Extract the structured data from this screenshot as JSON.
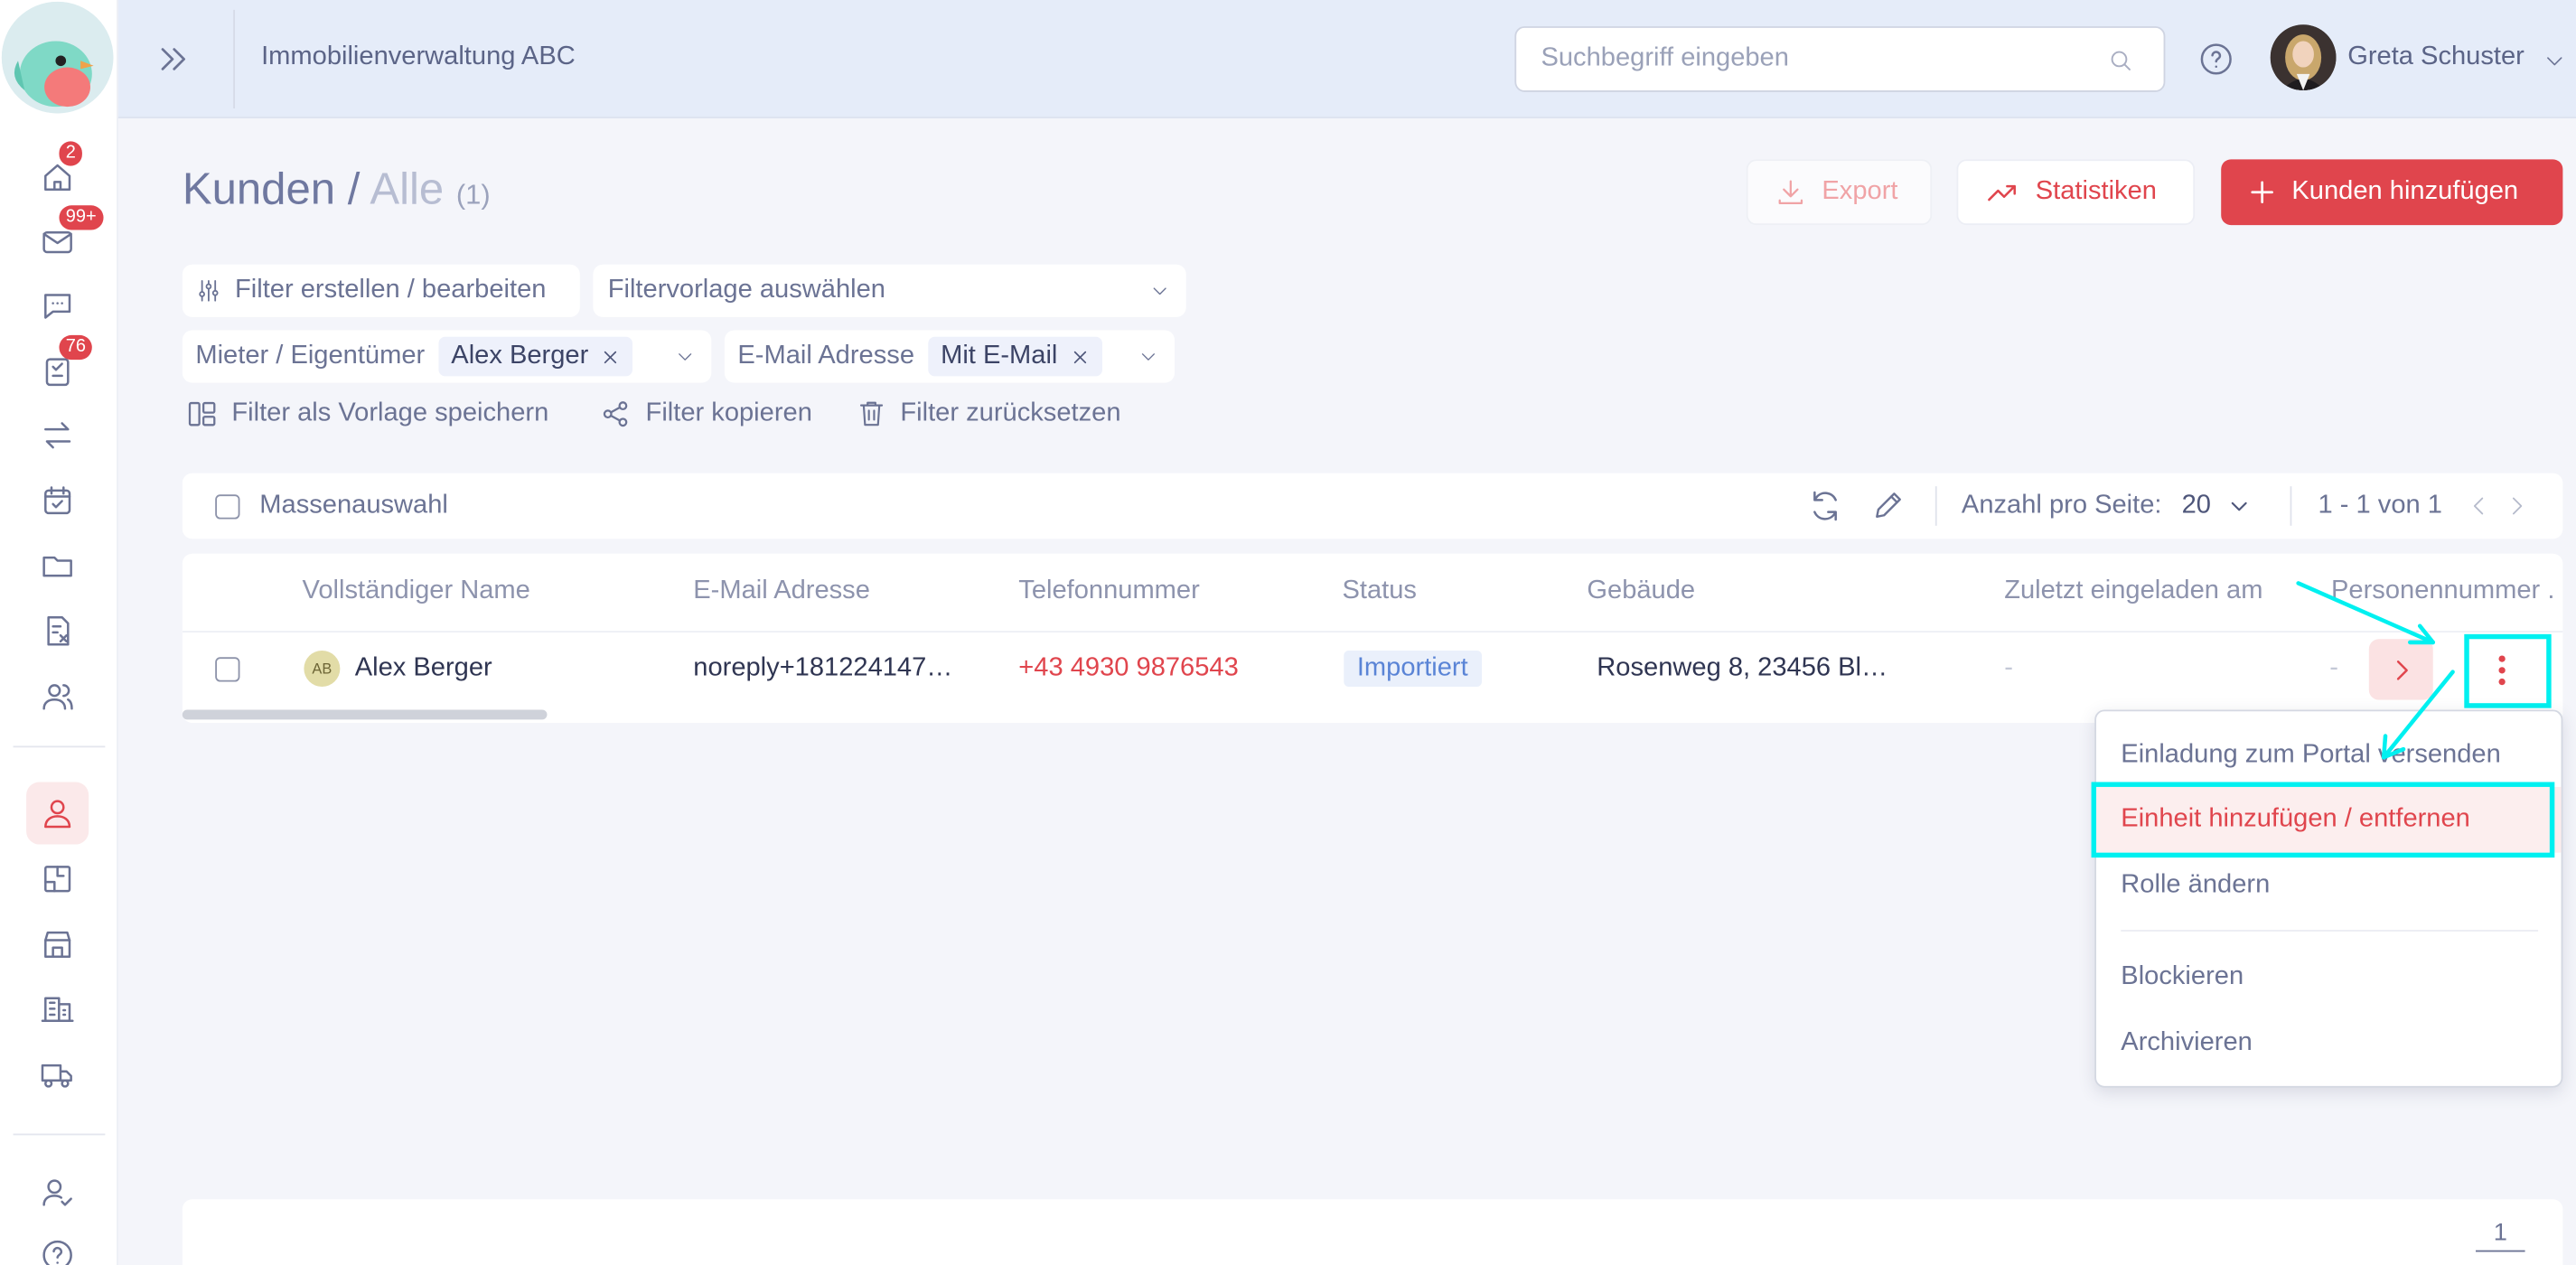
{
  "header": {
    "company": "Immobilienverwaltung ABC",
    "search_placeholder": "Suchbegriff eingeben",
    "user_name": "Greta Schuster"
  },
  "sidebar": {
    "badges": {
      "home": "2",
      "mail": "99+",
      "tasks": "76"
    }
  },
  "page": {
    "title": "Kunden",
    "separator": "/",
    "subtitle": "Alle",
    "count": "(1)",
    "export_label": "Export",
    "stats_label": "Statistiken",
    "add_label": "Kunden hinzufügen"
  },
  "filters": {
    "edit_label": "Filter erstellen / bearbeiten",
    "template_placeholder": "Filtervorlage auswählen",
    "tenant_label": "Mieter / Eigentümer",
    "tenant_value": "Alex Berger",
    "email_label": "E-Mail Adresse",
    "email_value": "Mit E-Mail",
    "save_template": "Filter als Vorlage speichern",
    "copy_filter": "Filter kopieren",
    "reset_filter": "Filter zurücksetzen"
  },
  "toolbar": {
    "bulk_select": "Massenauswahl",
    "per_page_label": "Anzahl pro Seite:",
    "per_page_value": "20",
    "range": "1 - 1 von 1"
  },
  "table": {
    "columns": [
      "Vollständiger Name",
      "E-Mail Adresse",
      "Telefonnummer",
      "Status",
      "Gebäude",
      "Zuletzt eingeladen am",
      "Personennummer ."
    ],
    "rows": [
      {
        "initials": "AB",
        "name": "Alex Berger",
        "email": "noreply+181224147…",
        "phone": "+43 4930 9876543",
        "status": "Importiert",
        "building": "Rosenweg 8, 23456 Bl…",
        "last_invited": "-",
        "person_number": "-"
      }
    ]
  },
  "menu": {
    "items": [
      "Einladung zum Portal versenden",
      "Einheit hinzufügen / entfernen",
      "Rolle ändern",
      "Blockieren",
      "Archivieren"
    ]
  },
  "footer": {
    "page": "1"
  },
  "colors": {
    "accent": "#e0454d",
    "header_bg": "#e5ecf9",
    "highlight": "#00f0f0",
    "status": "#5a84d6"
  }
}
